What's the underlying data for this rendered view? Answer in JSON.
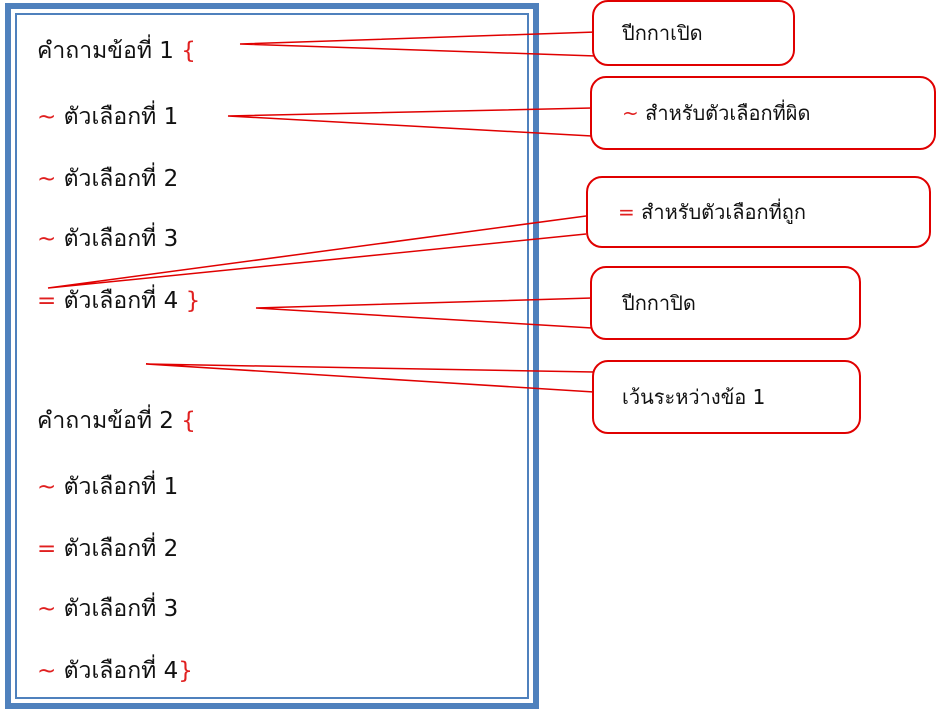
{
  "question1": {
    "label": "คำถามข้อที่ 1",
    "open_brace": "{",
    "choices": [
      {
        "mark": "~",
        "label": "ตัวเลือกที่ 1",
        "close": ""
      },
      {
        "mark": "~",
        "label": "ตัวเลือกที่ 2",
        "close": ""
      },
      {
        "mark": "~",
        "label": "ตัวเลือกที่ 3",
        "close": ""
      },
      {
        "mark": "=",
        "label": "ตัวเลือกที่ 4",
        "close": "}"
      }
    ]
  },
  "question2": {
    "label": "คำถามข้อที่ 2",
    "open_brace": "{",
    "choices": [
      {
        "mark": "~",
        "label": "ตัวเลือกที่ 1",
        "close": ""
      },
      {
        "mark": "=",
        "label": "ตัวเลือกที่ 2",
        "close": ""
      },
      {
        "mark": "~",
        "label": "ตัวเลือกที่ 3",
        "close": ""
      },
      {
        "mark": "~",
        "label": "ตัวเลือกที่ 4",
        "close": "}"
      }
    ]
  },
  "callouts": {
    "open_brace": {
      "text": "ปีกกาเปิด"
    },
    "wrong_choice": {
      "symbol": "~",
      "text": "สำหรับตัวเลือกที่ผิด"
    },
    "correct_choice": {
      "symbol": "=",
      "text": "สำหรับตัวเลือกที่ถูก"
    },
    "close_brace": {
      "text": "ปีกกาปิด"
    },
    "spacing": {
      "text": "เว้นระหว่างข้อ 1"
    }
  },
  "colors": {
    "frame": "#4f81bd",
    "callout_border": "#e00000",
    "symbol": "#e02020"
  }
}
